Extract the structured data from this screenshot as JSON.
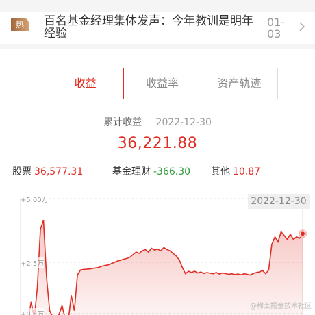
{
  "news": {
    "badge": "热",
    "title": "百名基金经理集体发声：今年教训是明年经验",
    "date": "01-03"
  },
  "tabs": [
    {
      "label": "收益",
      "active": true
    },
    {
      "label": "收益率",
      "active": false
    },
    {
      "label": "资产轨迹",
      "active": false
    }
  ],
  "summary": {
    "label": "累计收益",
    "date": "2022-12-30",
    "value": "36,221.88"
  },
  "breakdown": [
    {
      "label": "股票",
      "value": "36,577.31",
      "sign": "pos"
    },
    {
      "label": "基金理财",
      "value": "-366.30",
      "sign": "neg"
    },
    {
      "label": "其他",
      "value": "10.87",
      "sign": "pos"
    }
  ],
  "colors": {
    "accent": "#e02e24",
    "negative": "#2f9c3c",
    "badge": "#b97a45"
  },
  "chart_data": {
    "type": "area",
    "tooltip_date": "2022-12-30",
    "y_tick_labels": [
      "+5.00万",
      "+2.5万",
      "+0.5万"
    ],
    "y_ticks": [
      50000,
      25000,
      5000
    ],
    "ylim": [
      0,
      50000
    ],
    "grid": true,
    "series": [
      {
        "color": "#e02e24",
        "values": [
          2200,
          3500,
          1800,
          9500,
          3000,
          15000,
          38000,
          41500,
          19000,
          6000,
          3500,
          2200,
          4500,
          8000,
          3000,
          1800,
          12000,
          6000,
          20000,
          22000,
          22200,
          22300,
          22400,
          22600,
          22800,
          23000,
          23500,
          23800,
          24000,
          24500,
          25000,
          25500,
          25800,
          26200,
          26500,
          27000,
          28000,
          29000,
          28500,
          29500,
          30000,
          29000,
          30500,
          29800,
          30200,
          29500,
          30800,
          30000,
          29500,
          28500,
          27500,
          26000,
          23000,
          20500,
          21500,
          21000,
          21500,
          20800,
          21200,
          20600,
          21000,
          20700,
          20500,
          21000,
          20400,
          20800,
          20600,
          20300,
          20500,
          20200,
          20400,
          20100,
          20500,
          20300,
          20000,
          20600,
          21000,
          21200,
          21800,
          20500,
          22000,
          32000,
          35000,
          33000,
          37000,
          35500,
          34000,
          36000,
          34000,
          35000,
          34500,
          36221.88
        ]
      },
      {
        "color": "#2f9c3c",
        "values": [
          0,
          2200,
          1500,
          0,
          400,
          0,
          0,
          0,
          0,
          500,
          1200,
          0,
          900,
          0
        ]
      }
    ]
  },
  "watermark": "@稀土掘金技术社区"
}
